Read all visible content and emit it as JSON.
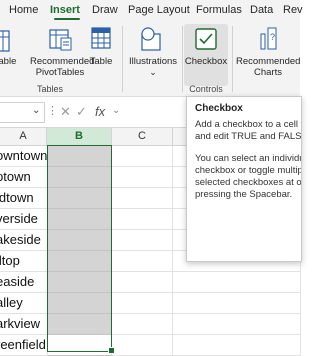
{
  "tabs": [
    "Home",
    "Insert",
    "Draw",
    "Page Layout",
    "Formulas",
    "Data",
    "Rev"
  ],
  "active_tab": "Insert",
  "ribbon": {
    "table_left": "Table",
    "recommended_pivot_line1": "Recommended",
    "recommended_pivot_line2": "PivotTables",
    "table": "Table",
    "illustrations": "Illustrations",
    "illustrations_caret": "⌄",
    "checkbox": "Checkbox",
    "recommended_charts_line1": "Recommended",
    "recommended_charts_line2": "Charts",
    "group_tables": "Tables",
    "group_controls": "Controls"
  },
  "formula_bar": {
    "namebox_caret": "⌄",
    "more": "⋮",
    "cancel": "✕",
    "enter": "✓",
    "fx": "fx",
    "fx_caret": "⌄"
  },
  "columns": [
    "A",
    "B",
    "C"
  ],
  "column_a_values": [
    "owntown",
    "ptown",
    "idtown",
    "verside",
    "akeside",
    "lltop",
    "easide",
    "alley",
    "arkview",
    "reenfield"
  ],
  "tooltip": {
    "title": "Checkbox",
    "line1": "Add a checkbox to a cell to dis",
    "line2": "and edit TRUE and FALSE value",
    "line3": "You can select an individual",
    "line4": "checkbox or toggle multiple",
    "line5": "selected checkboxes at once by",
    "line6": "pressing the Spacebar."
  },
  "colors": {
    "accent": "#1e6b34",
    "selection": "#d4d4d4",
    "ribbon_bg": "#f3f3f3"
  }
}
